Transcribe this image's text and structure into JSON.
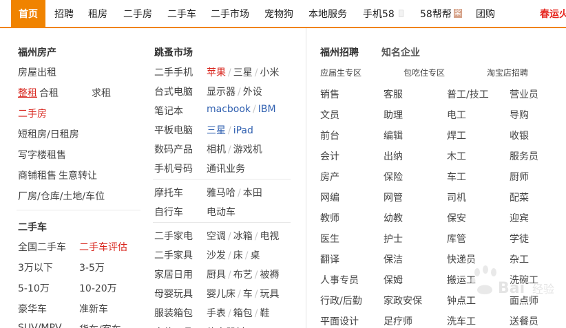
{
  "nav": {
    "items": [
      "首页",
      "招聘",
      "租房",
      "二手房",
      "二手车",
      "二手市场",
      "宠物狗",
      "本地服务",
      "手机58",
      "58帮帮",
      "团购"
    ],
    "badge": "桨",
    "promo": "春运火"
  },
  "fuzhou_house": {
    "title": "福州房产",
    "rent_house": "房屋出租",
    "whole_rent": "整租",
    "shared_rent": "合租",
    "want_rent": "求租",
    "second_house": "二手房",
    "short_rent": "短租房/日租房",
    "office": "写字楼租售",
    "shop": "商铺租售",
    "transfer": "生意转让",
    "factory": "厂房/仓库/土地/车位"
  },
  "used_car": {
    "title": "二手车",
    "national": "全国二手车",
    "evaluate": "二手车评估",
    "under3": "3万以下",
    "r3_5": "3-5万",
    "r5_10": "5-10万",
    "r10_20": "10-20万",
    "luxury": "豪华车",
    "quasi_new": "准新车",
    "suv": "SUV/MPV",
    "truck": "货车/客车"
  },
  "flea": {
    "title": "跳蚤市场",
    "rows": [
      {
        "label": "二手手机",
        "links": [
          "苹果",
          "三星",
          "小米"
        ]
      },
      {
        "label": "台式电脑",
        "links": [
          "显示器",
          "外设"
        ]
      },
      {
        "label": "笔记本",
        "links": [
          "macbook",
          "IBM"
        ]
      },
      {
        "label": "平板电脑",
        "links": [
          "三星",
          "iPad"
        ]
      },
      {
        "label": "数码产品",
        "links": [
          "相机",
          "游戏机"
        ]
      },
      {
        "label": "手机号码",
        "links": [
          "通讯业务"
        ]
      },
      {
        "label": "摩托车",
        "links": [
          "雅马哈",
          "本田"
        ]
      },
      {
        "label": "自行车",
        "links": [
          "电动车"
        ]
      },
      {
        "label": "二手家电",
        "links": [
          "空调",
          "冰箱",
          "电视"
        ]
      },
      {
        "label": "二手家具",
        "links": [
          "沙发",
          "床",
          "桌"
        ]
      },
      {
        "label": "家居日用",
        "links": [
          "厨具",
          "布艺",
          "被褥"
        ]
      },
      {
        "label": "母婴玩具",
        "links": [
          "婴儿床",
          "车",
          "玩具"
        ]
      },
      {
        "label": "服装箱包",
        "links": [
          "手表",
          "箱包",
          "鞋"
        ]
      },
      {
        "label": "文体用品",
        "links": [
          "体育器材"
        ]
      }
    ]
  },
  "jobs": {
    "title": "福州招聘",
    "famous": "知名企业",
    "zones": [
      "应届生专区",
      "包吃住专区",
      "淘宝店招聘"
    ],
    "grid": [
      [
        "销售",
        "客服",
        "普工/技工",
        "营业员"
      ],
      [
        "文员",
        "助理",
        "电工",
        "导购"
      ],
      [
        "前台",
        "编辑",
        "焊工",
        "收银"
      ],
      [
        "会计",
        "出纳",
        "木工",
        "服务员"
      ],
      [
        "房产",
        "保险",
        "车工",
        "厨师"
      ],
      [
        "网编",
        "网管",
        "司机",
        "配菜"
      ],
      [
        "教师",
        "幼教",
        "保安",
        "迎宾"
      ],
      [
        "医生",
        "护士",
        "库管",
        "学徒"
      ],
      [
        "翻译",
        "保洁",
        "快递员",
        "杂工"
      ],
      [
        "人事专员",
        "保姆",
        "搬运工",
        "洗碗工"
      ],
      [
        "行政/后勤",
        "家政安保",
        "钟点工",
        "面点师"
      ],
      [
        "平面设计",
        "足疗师",
        "洗车工",
        "送餐员"
      ]
    ]
  },
  "watermark": {
    "brand": "Bai",
    "sub": "经验"
  },
  "colors": {
    "accent": "#f08300",
    "red": "#d8251d",
    "blue": "#3060b0"
  }
}
